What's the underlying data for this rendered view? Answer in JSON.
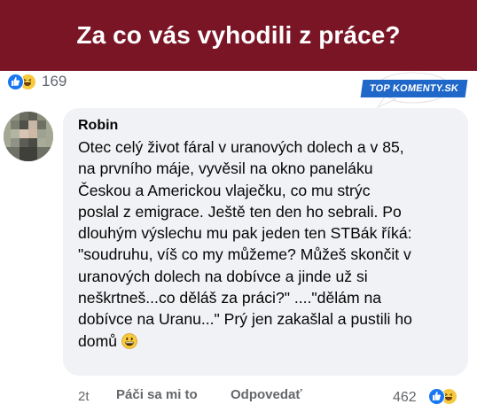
{
  "header": {
    "title": "Za co vás vyhodili z práce?"
  },
  "post_reactions": {
    "count": "169",
    "icons": [
      "like-icon",
      "haha-icon"
    ]
  },
  "badge": {
    "text": "TOP KOMENTY.SK"
  },
  "comment": {
    "author": "Robin",
    "lines": [
      "Otec celý život fáral v uranových dolech a v 85,",
      "na prvního máje, vyvěsil na okno paneláku",
      "Českou a Americkou vlaječku, co mu strýc",
      "poslal z emigrace. Ještě ten den ho sebrali. Po",
      "dlouhým výslechu mu pak jeden ten STBák říká:",
      "\"soudruhu, víš co my můžeme? Můžeš skončit v",
      "uranových dolech na dobívce a jinde už si",
      "neškrtneš...co děláš za práci?\" ....\"dělám na",
      "dobívce na Uranu...\" Prý jen zakašlal a pustili ho",
      "domů"
    ],
    "emoji": "grinning-face-icon"
  },
  "footer": {
    "time": "2t",
    "like_label": "Páči sa mi to",
    "reply_label": "Odpovedať",
    "reaction_count": "462"
  },
  "colors": {
    "header_bg": "#7a1526",
    "bubble_bg": "#f0f2f5",
    "like_blue": "#1877f2",
    "badge_blue": "#1f67c8"
  }
}
